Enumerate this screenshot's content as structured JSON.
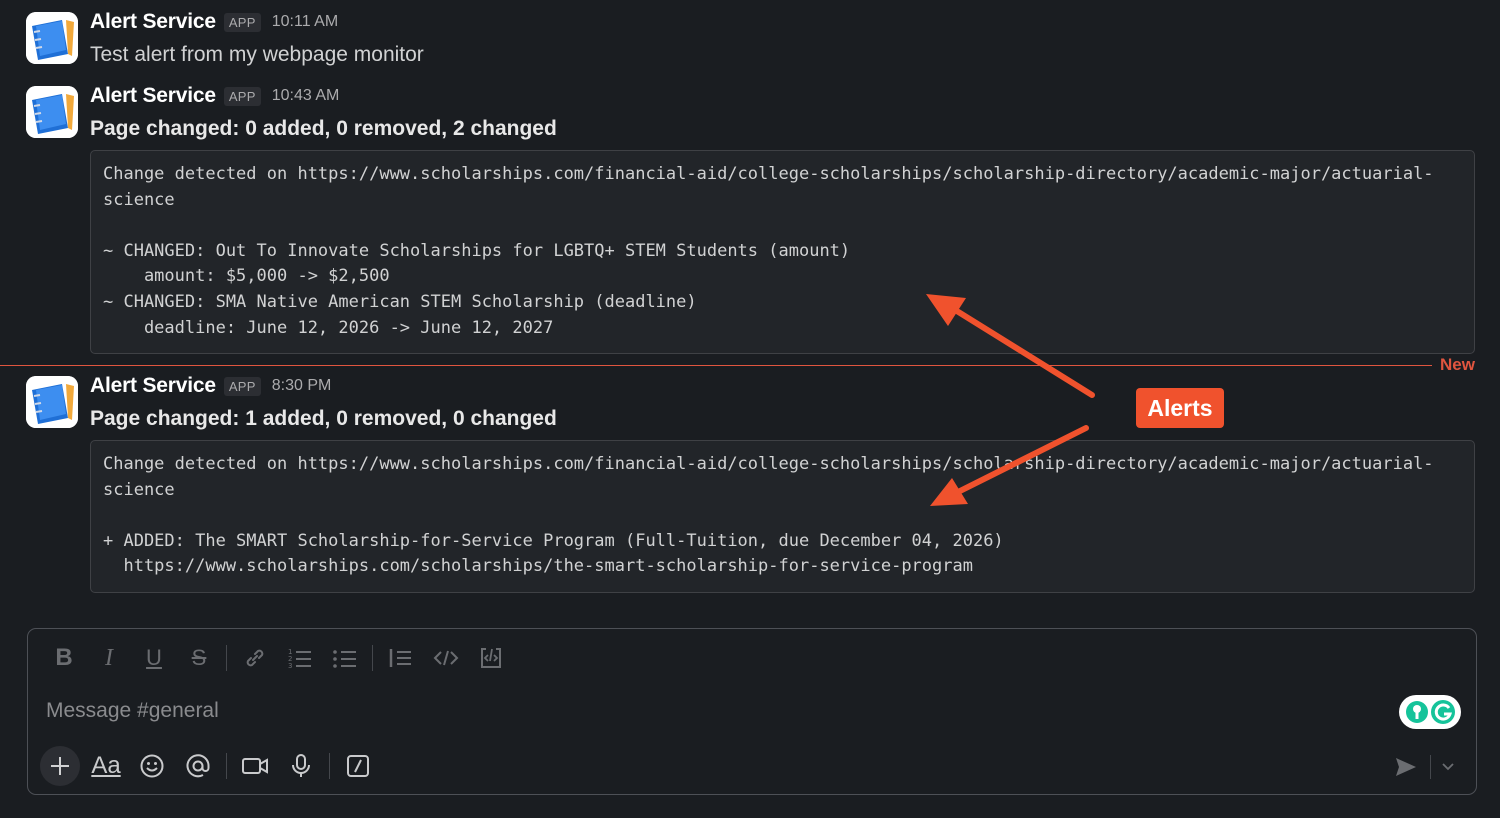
{
  "messages": [
    {
      "sender": "Alert Service",
      "badge": "APP",
      "time": "10:11 AM",
      "text": "Test alert from my webpage monitor"
    },
    {
      "sender": "Alert Service",
      "badge": "APP",
      "time": "10:43 AM",
      "text": "Page changed: 0 added, 0 removed, 2 changed",
      "code_lines": [
        "Change detected on https://www.scholarships.com/financial-aid/college-scholarships/scholarship-directory/academic-major/actuarial-",
        "science",
        "",
        "~ CHANGED: Out To Innovate Scholarships for LGBTQ+ STEM Students (amount)",
        "    amount: $5,000 -> $2,500",
        "~ CHANGED: SMA Native American STEM Scholarship (deadline)",
        "    deadline: June 12, 2026 -> June 12, 2027"
      ]
    },
    {
      "sender": "Alert Service",
      "badge": "APP",
      "time": "8:30 PM",
      "text": "Page changed: 1 added, 0 removed, 0 changed",
      "code_lines": [
        "Change detected on https://www.scholarships.com/financial-aid/college-scholarships/scholarship-directory/academic-major/actuarial-",
        "science",
        "",
        "+ ADDED: The SMART Scholarship-for-Service Program (Full-Tuition, due December 04, 2026)",
        "  https://www.scholarships.com/scholarships/the-smart-scholarship-for-service-program"
      ]
    }
  ],
  "divider": {
    "label": "New",
    "color": "#e0553f"
  },
  "annotation": {
    "label": "Alerts",
    "color": "#f0522d"
  },
  "composer": {
    "placeholder": "Message #general",
    "formatting_icons": [
      "bold-icon",
      "italic-icon",
      "underline-icon",
      "strikethrough-icon",
      "link-icon",
      "ordered-list-icon",
      "bulleted-list-icon",
      "blockquote-icon",
      "code-icon",
      "code-block-icon"
    ],
    "tool_icons": [
      "plus-icon",
      "text-format-icon",
      "emoji-icon",
      "mention-icon",
      "video-icon",
      "microphone-icon",
      "slash-command-icon"
    ],
    "aa_label": "Aa"
  }
}
